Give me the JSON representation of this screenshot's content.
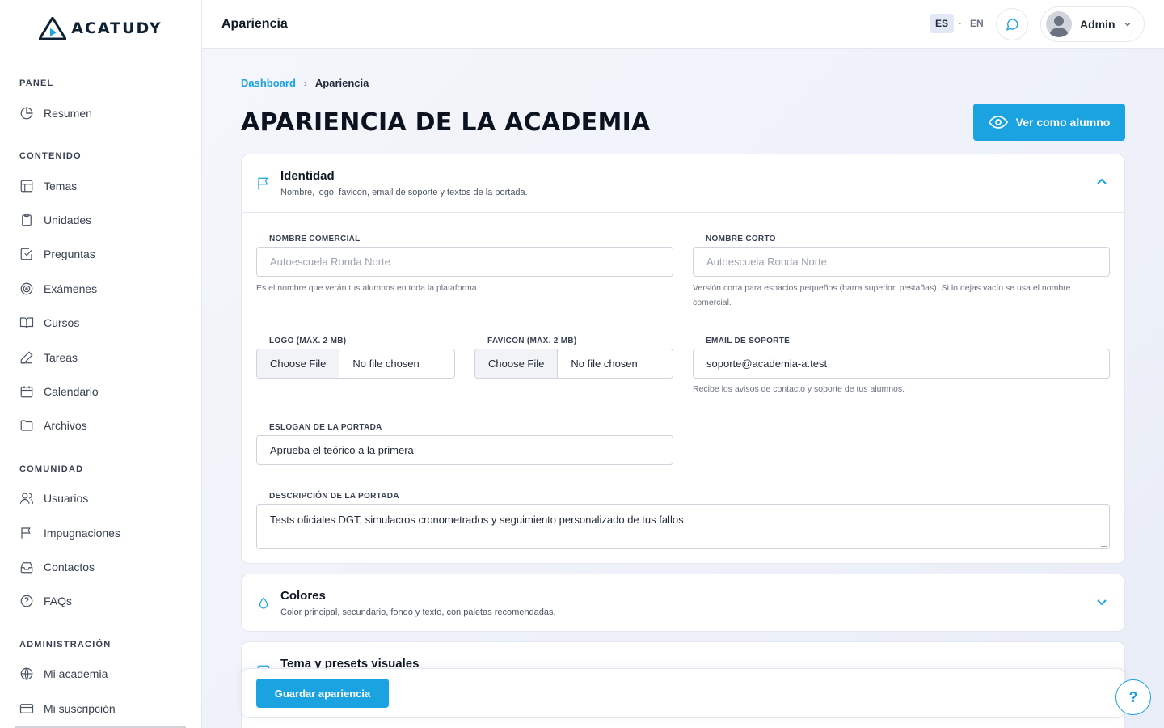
{
  "brand": {
    "name": "ACATUDY"
  },
  "sidebar": {
    "sections": [
      {
        "title": "PANEL",
        "items": [
          {
            "label": "Resumen",
            "icon": "pie-chart-icon"
          }
        ]
      },
      {
        "title": "CONTENIDO",
        "items": [
          {
            "label": "Temas",
            "icon": "layout-icon"
          },
          {
            "label": "Unidades",
            "icon": "clipboard-icon"
          },
          {
            "label": "Preguntas",
            "icon": "check-square-icon"
          },
          {
            "label": "Exámenes",
            "icon": "target-icon"
          },
          {
            "label": "Cursos",
            "icon": "book-open-icon"
          },
          {
            "label": "Tareas",
            "icon": "pen-icon"
          },
          {
            "label": "Calendario",
            "icon": "calendar-icon"
          },
          {
            "label": "Archivos",
            "icon": "folder-icon"
          }
        ]
      },
      {
        "title": "COMUNIDAD",
        "items": [
          {
            "label": "Usuarios",
            "icon": "users-icon"
          },
          {
            "label": "Impugnaciones",
            "icon": "flag-icon"
          },
          {
            "label": "Contactos",
            "icon": "inbox-icon"
          },
          {
            "label": "FAQs",
            "icon": "help-circle-icon"
          }
        ]
      },
      {
        "title": "ADMINISTRACIÓN",
        "items": [
          {
            "label": "Mi academia",
            "icon": "globe-icon"
          },
          {
            "label": "Mi suscripción",
            "icon": "credit-card-icon"
          }
        ]
      }
    ]
  },
  "topbar": {
    "title": "Apariencia",
    "lang_es": "ES",
    "lang_sep": "·",
    "lang_en": "EN",
    "user": "Admin"
  },
  "breadcrumb": {
    "root": "Dashboard",
    "sep": "›",
    "current": "Apariencia"
  },
  "page": {
    "title": "APARIENCIA DE LA ACADEMIA",
    "view_as_student": "Ver como alumno"
  },
  "identity": {
    "title": "Identidad",
    "subtitle": "Nombre, logo, favicon, email de soporte y textos de la portada.",
    "commercial_name_label": "NOMBRE COMERCIAL",
    "commercial_name_placeholder": "Autoescuela Ronda Norte",
    "commercial_name_help": "Es el nombre que verán tus alumnos en toda la plataforma.",
    "short_name_label": "NOMBRE CORTO",
    "short_name_placeholder": "Autoescuela Ronda Norte",
    "short_name_help": "Versión corta para espacios pequeños (barra superior, pestañas). Si lo dejas vacío se usa el nombre comercial.",
    "logo_label": "LOGO (MÁX. 2 MB)",
    "favicon_label": "FAVICON (MÁX. 2 MB)",
    "choose_file": "Choose File",
    "no_file": "No file chosen",
    "support_email_label": "EMAIL DE SOPORTE",
    "support_email_value": "soporte@academia-a.test",
    "support_email_help": "Recibe los avisos de contacto y soporte de tus alumnos.",
    "slogan_label": "ESLOGAN DE LA PORTADA",
    "slogan_value": "Aprueba el teórico a la primera",
    "description_label": "DESCRIPCIÓN DE LA PORTADA",
    "description_value": "Tests oficiales DGT, simulacros cronometrados y seguimiento personalizado de tus fallos."
  },
  "colors": {
    "title": "Colores",
    "subtitle": "Color principal, secundario, fondo y texto, con paletas recomendadas."
  },
  "theme": {
    "title": "Tema y presets visuales"
  },
  "save_button": "Guardar apariencia",
  "help_button": "?",
  "accent_color": "#1aa3e0"
}
